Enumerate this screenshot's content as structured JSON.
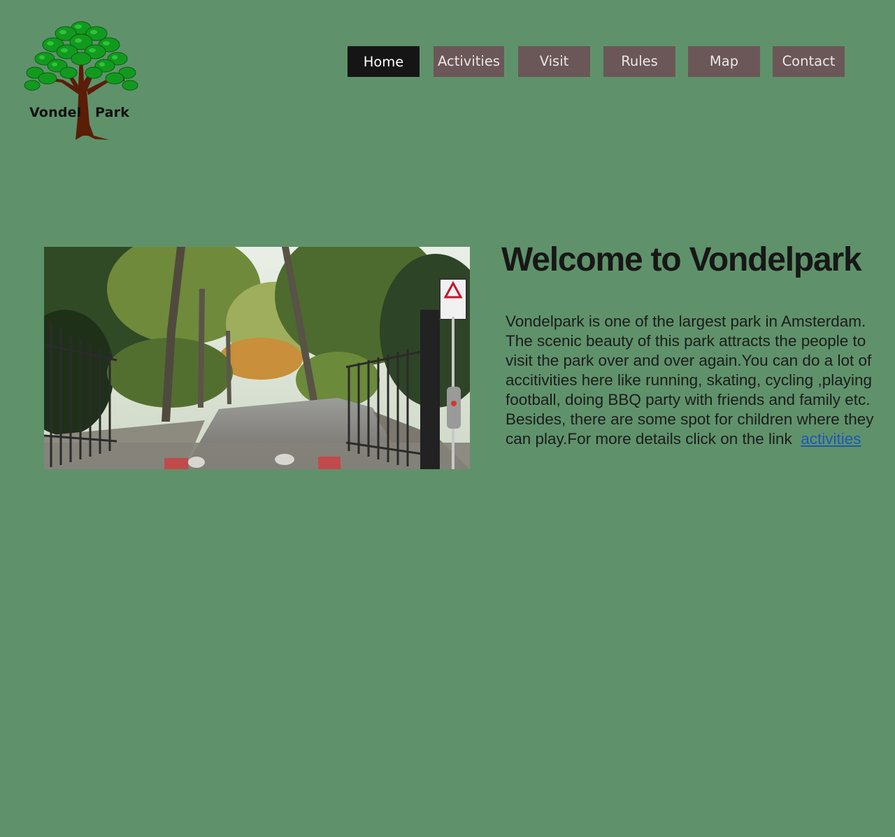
{
  "logo": {
    "word_left": "Vondel",
    "word_right": "Park"
  },
  "nav": {
    "items": [
      {
        "label": "Home",
        "active": true
      },
      {
        "label": "Activities",
        "active": false
      },
      {
        "label": "Visit",
        "active": false
      },
      {
        "label": "Rules",
        "active": false
      },
      {
        "label": "Map",
        "active": false
      },
      {
        "label": "Contact",
        "active": false
      }
    ]
  },
  "main": {
    "heading": "Welcome to Vondelpark",
    "description": "Vondelpark is one of the largest park in Amsterdam. The scenic beauty of this park attracts the people to visit the park over and over again.You can do a lot of accitivities here  like running, skating, cycling ,playing football, doing BBQ party with friends and family etc. Besides, there are some spot for children where they can play.For more details click on the link",
    "link_text": "activities"
  },
  "colors": {
    "background": "#5f926b",
    "nav_inactive": "#6b5757",
    "nav_active": "#151515",
    "link": "#1f56b8"
  }
}
